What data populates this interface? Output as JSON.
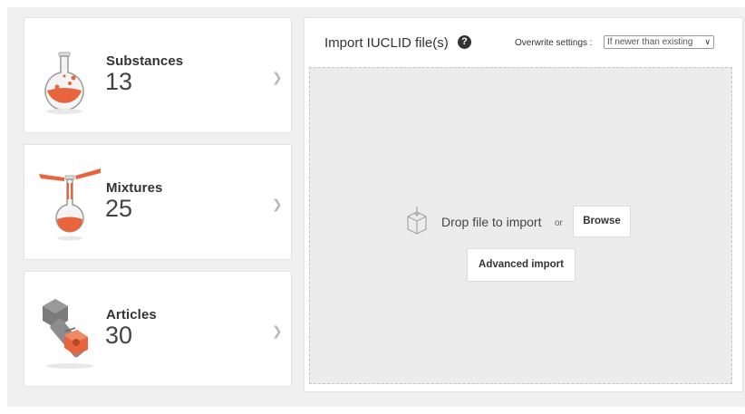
{
  "cards": [
    {
      "name": "Substances",
      "count": "13",
      "icon": "flask-icon"
    },
    {
      "name": "Mixtures",
      "count": "25",
      "icon": "mixing-flasks-icon"
    },
    {
      "name": "Articles",
      "count": "30",
      "icon": "bolt-nut-icon"
    }
  ],
  "import_panel": {
    "title": "Import IUCLID file(s)",
    "help": "?",
    "overwrite_label": "Overwrite settings :",
    "overwrite_value": "If newer than existing",
    "drop_text": "Drop file to import",
    "or_text": "or",
    "browse_label": "Browse",
    "advanced_label": "Advanced import"
  },
  "colors": {
    "accent": "#e8643c",
    "background": "#f0f0f0",
    "card": "#ffffff"
  }
}
